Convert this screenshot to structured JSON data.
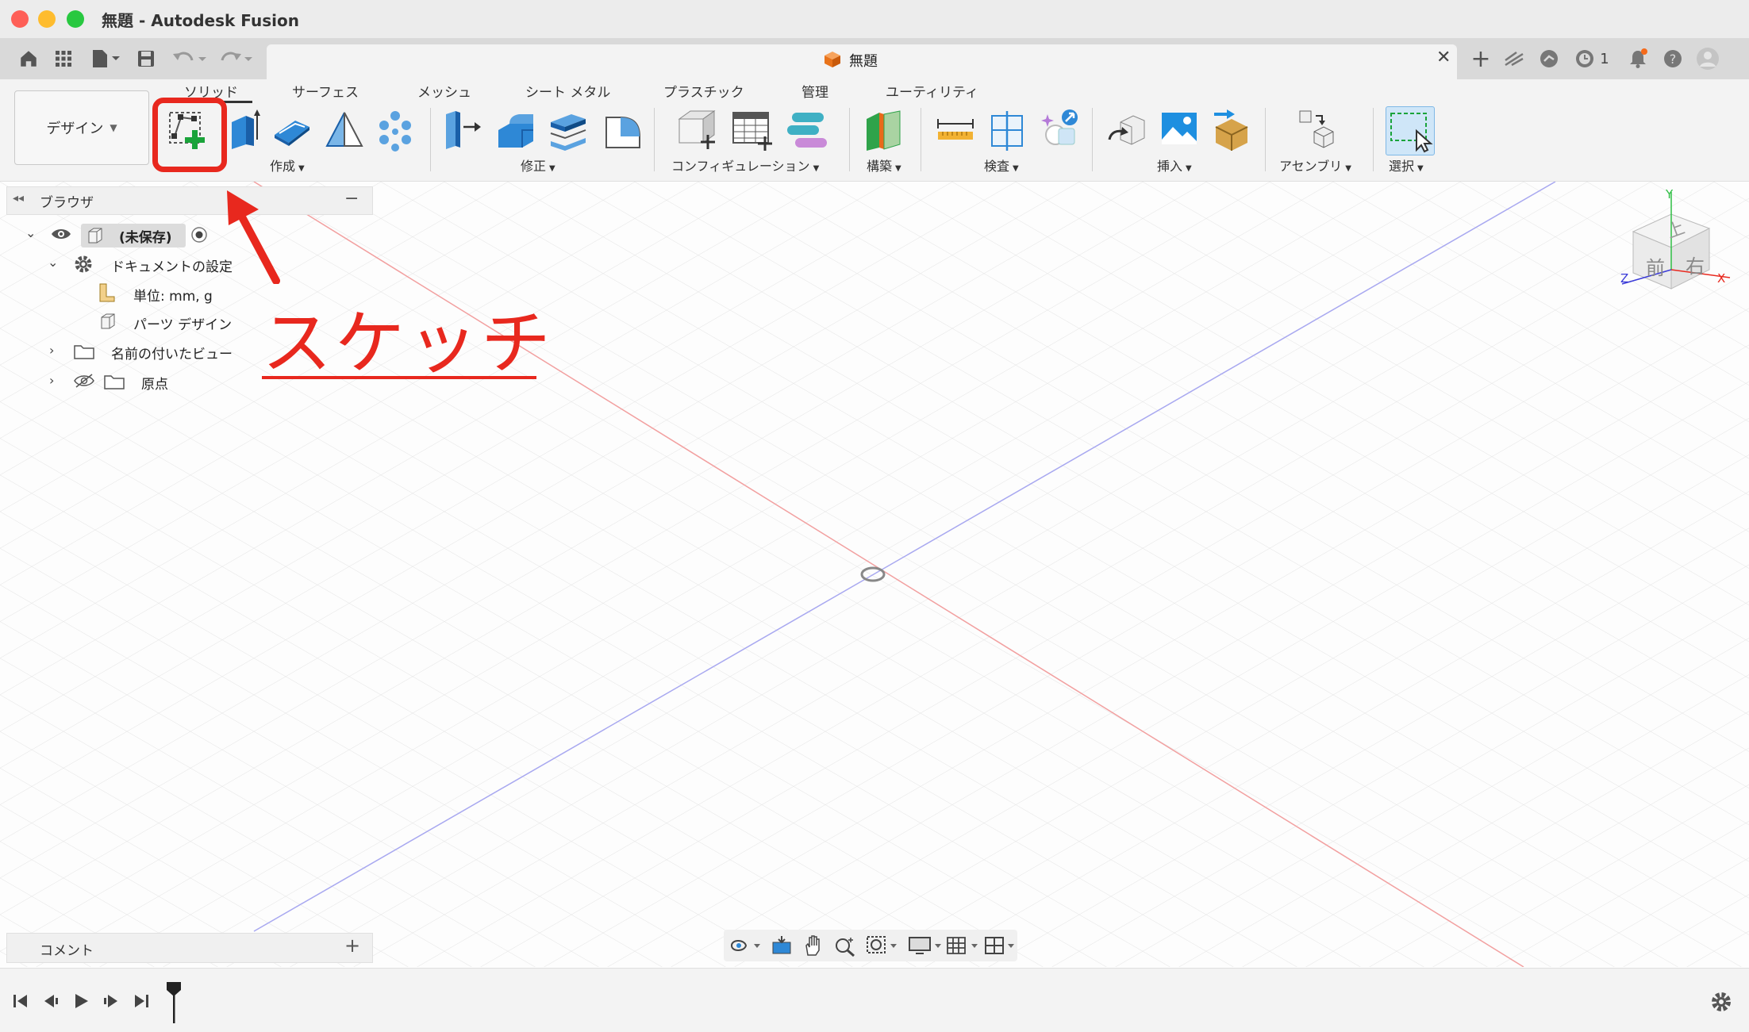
{
  "window": {
    "title": "無題 - Autodesk Fusion"
  },
  "quick_access": {
    "doc_tab_title": "無題",
    "jobs_count": "1"
  },
  "toolbar": {
    "workspace_label": "デザイン",
    "tabs": [
      "ソリッド",
      "サーフェス",
      "メッシュ",
      "シート メタル",
      "プラスチック",
      "管理",
      "ユーティリティ"
    ],
    "active_tab": "ソリッド",
    "groups": {
      "create": "作成",
      "modify": "修正",
      "configure": "コンフィギュレーション",
      "construct": "構築",
      "inspect": "検査",
      "insert": "挿入",
      "assemble": "アセンブリ",
      "select": "選択"
    }
  },
  "browser": {
    "title": "ブラウザ",
    "root_label": "(未保存)",
    "doc_settings": "ドキュメントの設定",
    "units": "単位: mm, g",
    "design_type": "パーツ デザイン",
    "named_views": "名前の付いたビュー",
    "origin": "原点"
  },
  "comments": {
    "title": "コメント"
  },
  "viewcube": {
    "top": "上",
    "front": "前",
    "right": "右",
    "axis_x": "X",
    "axis_y": "Y",
    "axis_z": "Z"
  },
  "annotation": {
    "label": "スケッチ",
    "color": "#e8281e"
  },
  "colors": {
    "accent_blue": "#1e8fe0",
    "highlight_red": "#e8281e",
    "x_axis": "#f2a0a0",
    "z_axis": "#a8a8f0"
  }
}
